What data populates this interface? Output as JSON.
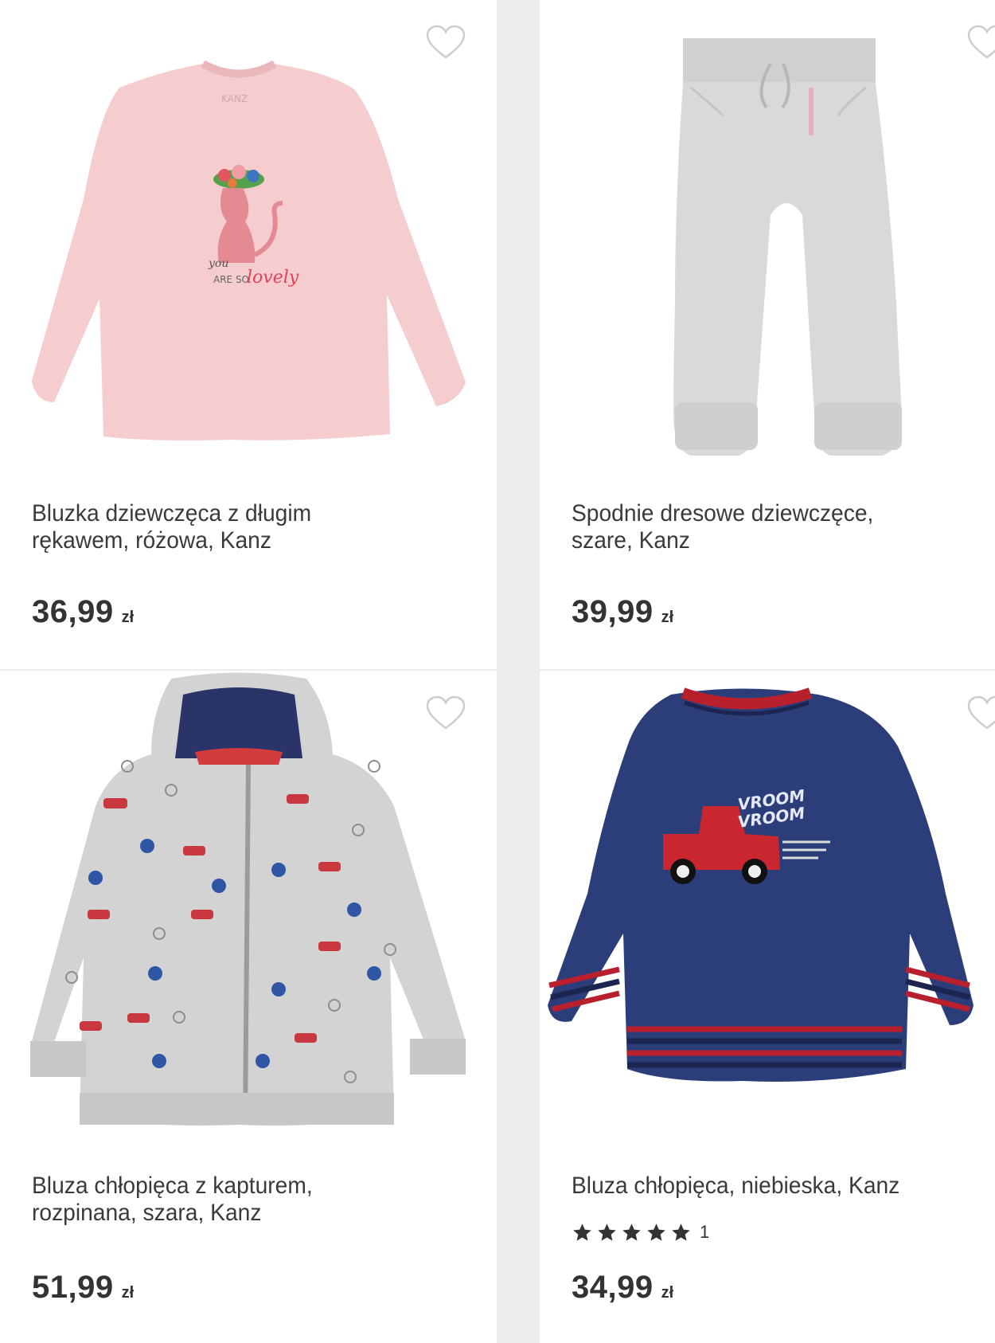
{
  "products": [
    {
      "name_line1": "Bluzka dziewczęca z długim",
      "name_line2": "rękawem, różowa, Kanz",
      "price": "36,99",
      "currency": "zł",
      "image_icon": "pink-blouse-image"
    },
    {
      "name_line1": "Spodnie dresowe dziewczęce,",
      "name_line2": "szare, Kanz",
      "price": "39,99",
      "currency": "zł",
      "image_icon": "grey-sweatpants-image"
    },
    {
      "name_line1": "Bluza chłopięca z kapturem,",
      "name_line2": "rozpinana, szara, Kanz",
      "price": "51,99",
      "currency": "zł",
      "image_icon": "grey-hoodie-image"
    },
    {
      "name_line1": "Bluza chłopięca, niebieska, Kanz",
      "name_line2": "",
      "price": "34,99",
      "currency": "zł",
      "rating_stars": 5,
      "rating_count": "1",
      "image_icon": "navy-sweatshirt-image"
    }
  ],
  "colors": {
    "text": "#3a3a3a",
    "price": "#333333",
    "heart": "#cccccc",
    "star": "#333333",
    "background": "#ececec"
  }
}
